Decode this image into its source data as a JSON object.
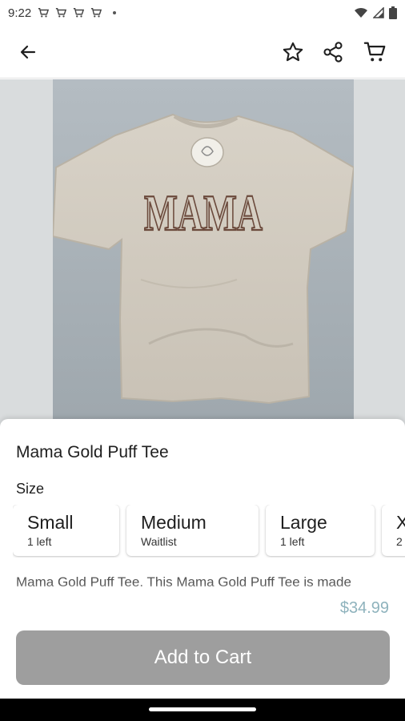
{
  "status_bar": {
    "time": "9:22",
    "notification_icons": [
      "cart-icon",
      "cart-icon",
      "cart-icon",
      "cart-icon"
    ],
    "right_icons": [
      "wifi-icon",
      "signal-icon",
      "battery-icon"
    ]
  },
  "app_bar": {
    "back_icon": "arrow-left-icon",
    "actions": [
      "star-icon",
      "share-icon",
      "cart-icon"
    ]
  },
  "product": {
    "title": "Mama Gold Puff Tee",
    "size_label": "Size",
    "sizes": [
      {
        "name": "Small",
        "stock": "1 left"
      },
      {
        "name": "Medium",
        "stock": "Waitlist"
      },
      {
        "name": "Large",
        "stock": "1 left"
      },
      {
        "name": "X",
        "stock": "2"
      }
    ],
    "description": "Mama Gold Puff Tee. This Mama Gold Puff Tee is made",
    "price": "$34.99",
    "add_to_cart_label": "Add to Cart",
    "image_print_text": "MAMA"
  },
  "colors": {
    "price": "#8fb3bd",
    "add_button": "#9e9e9e",
    "tee": "#d7d1c6",
    "print_outline": "#6b4a3c"
  }
}
